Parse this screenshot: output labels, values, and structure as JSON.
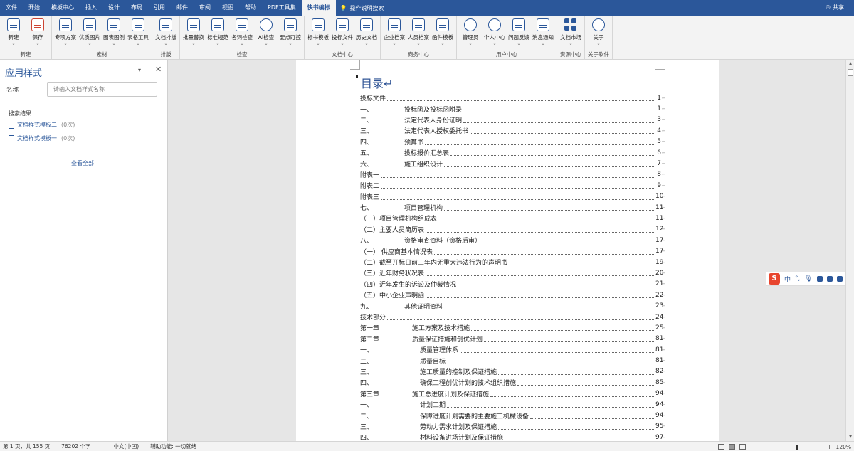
{
  "menu": {
    "tabs": [
      "文件",
      "开始",
      "模板中心",
      "插入",
      "设计",
      "布局",
      "引用",
      "邮件",
      "审阅",
      "视图",
      "帮助",
      "PDF工具集",
      "快书编标"
    ],
    "active_tab": "快书编标",
    "tell_me": "操作说明搜索",
    "share": "共享"
  },
  "ribbon": {
    "groups": [
      {
        "label": "新建",
        "buttons": [
          {
            "label": "新建",
            "icon": "new-doc-icon"
          },
          {
            "label": "保存",
            "icon": "save-icon"
          }
        ]
      },
      {
        "label": "素材",
        "buttons": [
          {
            "label": "专项方案",
            "icon": "doc-plan-icon"
          },
          {
            "label": "优质图片",
            "icon": "image-icon"
          },
          {
            "label": "图表图例",
            "icon": "chart-icon"
          },
          {
            "label": "表格工具",
            "icon": "table-icon"
          }
        ]
      },
      {
        "label": "排版",
        "buttons": [
          {
            "label": "文档排版",
            "icon": "layout-icon"
          }
        ]
      },
      {
        "label": "检查",
        "buttons": [
          {
            "label": "批量替换",
            "icon": "replace-icon"
          },
          {
            "label": "标准规范",
            "icon": "standard-icon"
          },
          {
            "label": "名词检查",
            "icon": "term-check-icon"
          },
          {
            "label": "AI检查",
            "icon": "ai-check-icon"
          },
          {
            "label": "要点盯控",
            "icon": "focus-icon"
          }
        ]
      },
      {
        "label": "文档中心",
        "buttons": [
          {
            "label": "标书模板",
            "icon": "bid-template-icon"
          },
          {
            "label": "投标文件",
            "icon": "bid-file-icon"
          },
          {
            "label": "历史文档",
            "icon": "history-doc-icon"
          }
        ]
      },
      {
        "label": "商务中心",
        "buttons": [
          {
            "label": "企业档案",
            "icon": "company-icon"
          },
          {
            "label": "人员档案",
            "icon": "person-icon"
          },
          {
            "label": "函件模板",
            "icon": "letter-icon"
          }
        ]
      },
      {
        "label": "用户中心",
        "buttons": [
          {
            "label": "管理员",
            "icon": "admin-icon"
          },
          {
            "label": "个人中心",
            "icon": "user-icon"
          },
          {
            "label": "问题反馈",
            "icon": "feedback-icon"
          },
          {
            "label": "消息通知",
            "icon": "bell-icon"
          }
        ]
      },
      {
        "label": "资源中心",
        "buttons": [
          {
            "label": "文档市场",
            "icon": "market-icon"
          }
        ]
      },
      {
        "label": "关于软件",
        "buttons": [
          {
            "label": "关于",
            "icon": "about-icon"
          }
        ]
      }
    ]
  },
  "pane": {
    "title": "应用样式",
    "name_label": "名称",
    "name_placeholder": "请输入文档样式名称",
    "results_label": "搜索结果",
    "results": [
      {
        "name": "文档样式模板二",
        "count": "(0次)"
      },
      {
        "name": "文档样式模板一",
        "count": "(0次)"
      }
    ],
    "view_all": "查看全部"
  },
  "document": {
    "toc_title": "目录↵",
    "toc": [
      {
        "num": "",
        "text": "投标文件",
        "page": "1",
        "indent": 0
      },
      {
        "num": "一、",
        "text": "投标函及投标函附录",
        "page": "1",
        "indent": 62
      },
      {
        "num": "二、",
        "text": "法定代表人身份证明",
        "page": "3",
        "indent": 62
      },
      {
        "num": "三、",
        "text": "法定代表人授权委托书",
        "page": "4",
        "indent": 62
      },
      {
        "num": "四、",
        "text": "预算书",
        "page": "5",
        "indent": 62
      },
      {
        "num": "五、",
        "text": "投标报价汇总表",
        "page": "6",
        "indent": 62
      },
      {
        "num": "六、",
        "text": "施工组织设计",
        "page": "7",
        "indent": 62
      },
      {
        "num": "",
        "text": "附表一",
        "page": "8",
        "indent": 0
      },
      {
        "num": "",
        "text": "附表二",
        "page": "9",
        "indent": 0
      },
      {
        "num": "",
        "text": "附表三",
        "page": "10",
        "indent": 0
      },
      {
        "num": "七、",
        "text": "项目管理机构",
        "page": "11",
        "indent": 62
      },
      {
        "num": "",
        "text": "（一）项目管理机构组成表",
        "page": "11",
        "indent": 0
      },
      {
        "num": "",
        "text": "（二）主要人员简历表",
        "page": "12",
        "indent": 0
      },
      {
        "num": "八、",
        "text": "资格审查资料（资格后审）",
        "page": "17",
        "indent": 62
      },
      {
        "num": "",
        "text": "（一）  供应商基本情况表",
        "page": "17",
        "indent": 0
      },
      {
        "num": "",
        "text": "（二）截至开标日前三年内无重大违法行为的声明书",
        "page": "19",
        "indent": 0
      },
      {
        "num": "",
        "text": "（三）近年财务状况表",
        "page": "20",
        "indent": 0
      },
      {
        "num": "",
        "text": "（四）近年发生的诉讼及仲裁情况",
        "page": "21",
        "indent": 0
      },
      {
        "num": "",
        "text": "（五）中小企业声明函",
        "page": "22",
        "indent": 0
      },
      {
        "num": "九、",
        "text": "其他证明资料",
        "page": "23",
        "indent": 62
      },
      {
        "num": "",
        "text": "技术部分",
        "page": "24",
        "indent": 0
      },
      {
        "num": "第一章",
        "text": "施工方案及技术措施",
        "page": "25",
        "indent": 73
      },
      {
        "num": "第二章",
        "text": "质量保证措施和创优计划",
        "page": "81",
        "indent": 73
      },
      {
        "num": "一、",
        "text": "质量管理体系",
        "page": "81",
        "indent": 84
      },
      {
        "num": "二、",
        "text": "质量目标",
        "page": "81",
        "indent": 84
      },
      {
        "num": "三、",
        "text": "施工质量的控制及保证措施",
        "page": "82",
        "indent": 84
      },
      {
        "num": "四、",
        "text": "确保工程创优计划的技术组织措施",
        "page": "85",
        "indent": 84
      },
      {
        "num": "第三章",
        "text": "施工总进度计划及保证措施",
        "page": "94",
        "indent": 73
      },
      {
        "num": "一、",
        "text": "计划工期",
        "page": "94",
        "indent": 84
      },
      {
        "num": "二、",
        "text": "保障进度计划需要的主要施工机械设备",
        "page": "94",
        "indent": 84
      },
      {
        "num": "三、",
        "text": "劳动力需求计划及保证措施",
        "page": "95",
        "indent": 84
      },
      {
        "num": "四、",
        "text": "材料设备进场计划及保证措施",
        "page": "97",
        "indent": 84
      }
    ]
  },
  "ime": {
    "logo": "S",
    "mode": "中",
    "punct": "°,"
  },
  "status": {
    "page": "第 1 页，共 155 页",
    "words": "76202 个字",
    "lang": "中文(中国)",
    "accessibility": "辅助功能: 一切就绪",
    "zoom_minus": "−",
    "zoom_plus": "+",
    "zoom": "120%"
  }
}
